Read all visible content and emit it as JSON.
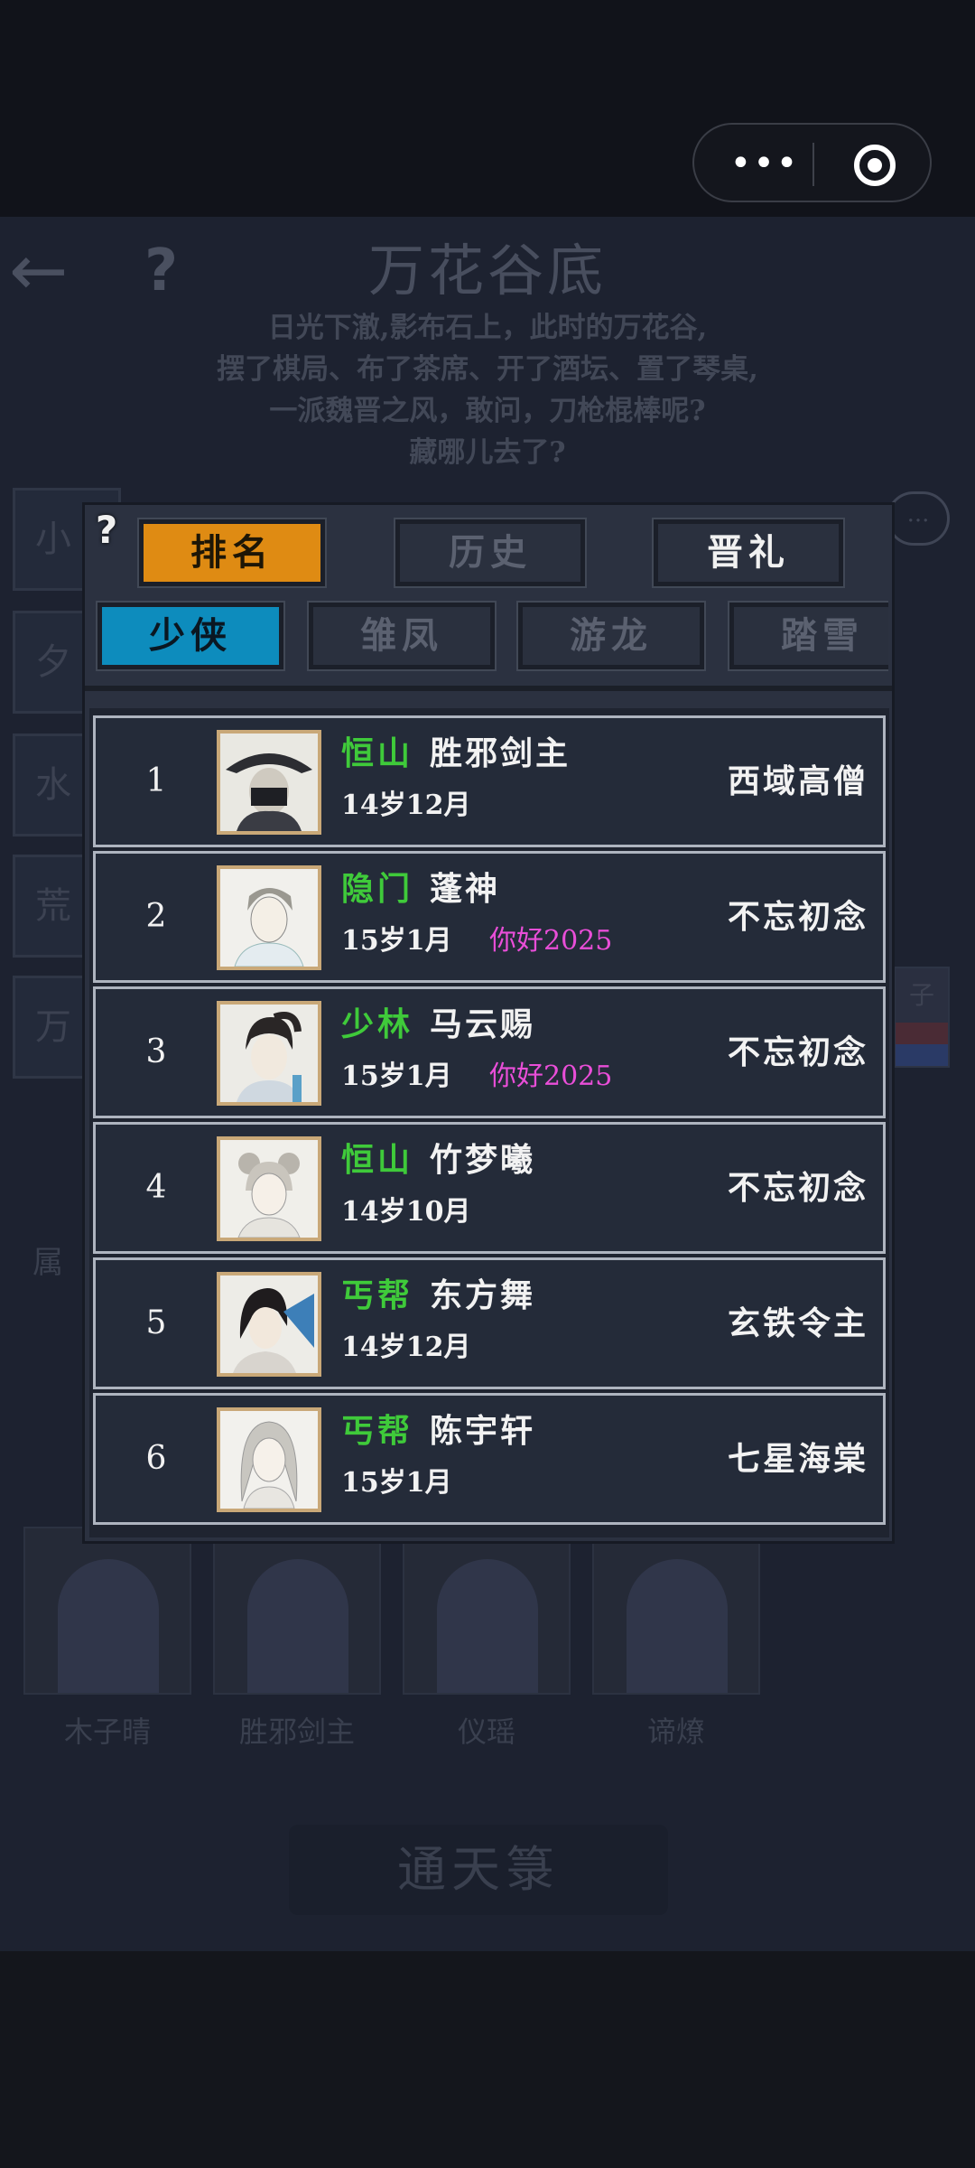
{
  "system": {
    "more_label": "•••"
  },
  "scene": {
    "back_icon": "←",
    "help_icon": "?",
    "title": "万花谷底",
    "intro_lines": [
      "日光下澈,影布石上，此时的万花谷,",
      "摆了棋局、布了茶席、开了酒坛、置了琴桌,",
      "一派魏晋之风，敢问，刀枪棍棒呢?",
      "藏哪儿去了?"
    ],
    "side_buttons": [
      "小",
      "夕",
      "水",
      "荒",
      "万"
    ],
    "chat_icon": "...",
    "right_tag": "子",
    "attr_label": "属",
    "heroes": [
      "木子晴",
      "胜邪剑主",
      "仪瑶",
      "谛燎"
    ],
    "bottom_button": "通天箓"
  },
  "modal": {
    "help_icon": "?",
    "main_tabs": [
      {
        "label": "排名",
        "active": true
      },
      {
        "label": "历史",
        "active": false
      },
      {
        "label": "晋礼",
        "active": false
      }
    ],
    "sub_tabs": [
      {
        "label": "少侠",
        "active": true
      },
      {
        "label": "雏凤",
        "active": false
      },
      {
        "label": "游龙",
        "active": false
      },
      {
        "label": "踏雪",
        "active": false
      }
    ],
    "rankings": [
      {
        "rank": "1",
        "sect": "恒山",
        "name": "胜邪剑主",
        "age": "14岁12月",
        "motto": "",
        "title": "西域高僧",
        "avatar_icon": "masked-swordsman-portrait-icon"
      },
      {
        "rank": "2",
        "sect": "隐门",
        "name": "蓬神",
        "age": "15岁1月",
        "motto": "你好2025",
        "title": "不忘初念",
        "avatar_icon": "white-robed-youth-portrait-icon"
      },
      {
        "rank": "3",
        "sect": "少林",
        "name": "马云赐",
        "age": "15岁1月",
        "motto": "你好2025",
        "title": "不忘初念",
        "avatar_icon": "ponytail-swordsman-portrait-icon"
      },
      {
        "rank": "4",
        "sect": "恒山",
        "name": "竹梦曦",
        "age": "14岁10月",
        "motto": "",
        "title": "不忘初念",
        "avatar_icon": "young-maiden-portrait-icon"
      },
      {
        "rank": "5",
        "sect": "丐帮",
        "name": "东方舞",
        "age": "14岁12月",
        "motto": "",
        "title": "玄铁令主",
        "avatar_icon": "fan-lady-portrait-icon"
      },
      {
        "rank": "6",
        "sect": "丐帮",
        "name": "陈宇轩",
        "age": "15岁1月",
        "motto": "",
        "title": "七星海棠",
        "avatar_icon": "long-haired-scholar-portrait-icon"
      }
    ]
  },
  "colors": {
    "sect_green": "#3fca3a",
    "motto_pink": "#e94ed8",
    "tab_orange": "#df8b13",
    "tab_blue": "#0d8cbd"
  }
}
